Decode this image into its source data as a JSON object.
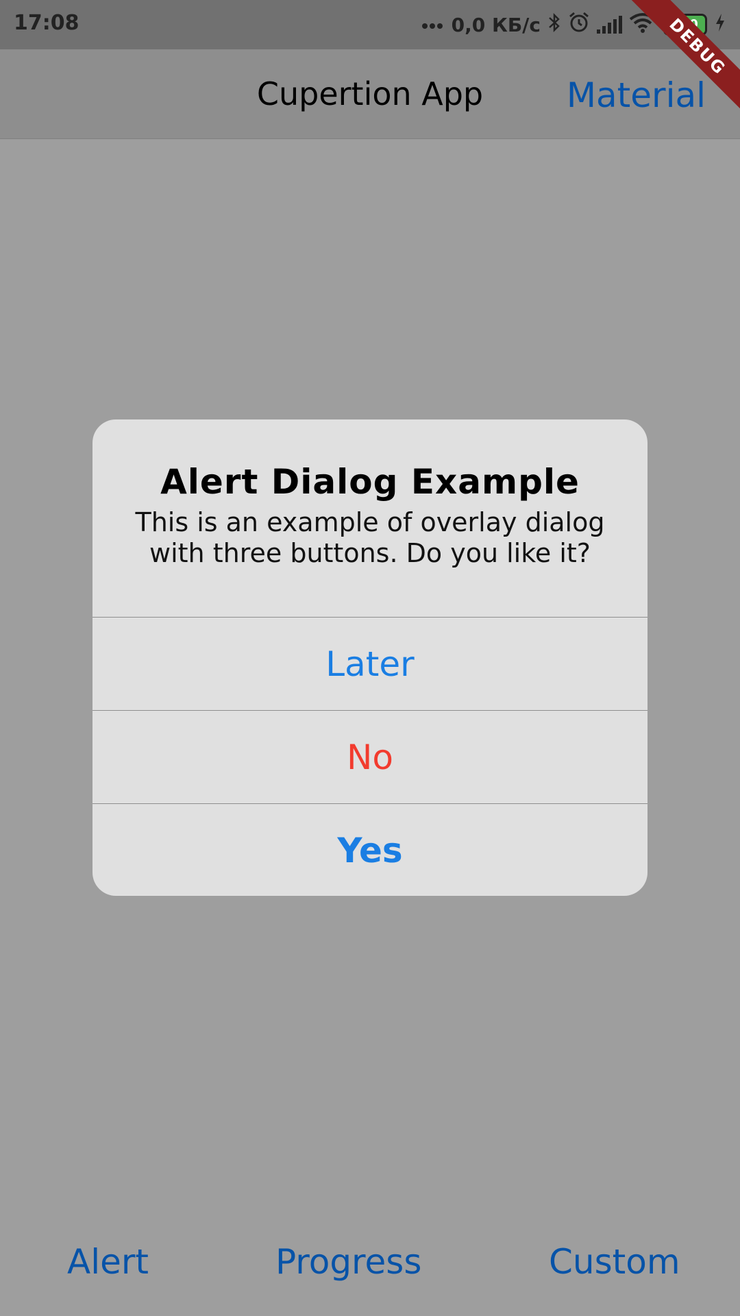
{
  "status_bar": {
    "time": "17:08",
    "network_speed": "0,0 КБ/с",
    "battery_level": "100",
    "icons": [
      "more-dots-icon",
      "bluetooth-icon",
      "alarm-icon",
      "signal-icon",
      "wifi-icon",
      "battery-icon",
      "charging-icon"
    ]
  },
  "debug_banner": "DEBUG",
  "nav_bar": {
    "title": "Cupertion App",
    "action_label": "Material"
  },
  "dialog": {
    "title": "Alert Dialog Example",
    "message": "This is an example of overlay dialog with three buttons. Do you like it?",
    "actions": [
      {
        "label": "Later",
        "color": "#1a7ee3"
      },
      {
        "label": "No",
        "color": "#f23b2e"
      },
      {
        "label": "Yes",
        "color": "#1a7ee3"
      }
    ]
  },
  "bottom_tabs": [
    {
      "label": "Alert"
    },
    {
      "label": "Progress"
    },
    {
      "label": "Custom"
    }
  ],
  "colors": {
    "link_blue": "#0753a8",
    "scrim": "#9e9e9e",
    "dialog_bg": "#e0e0e0"
  }
}
